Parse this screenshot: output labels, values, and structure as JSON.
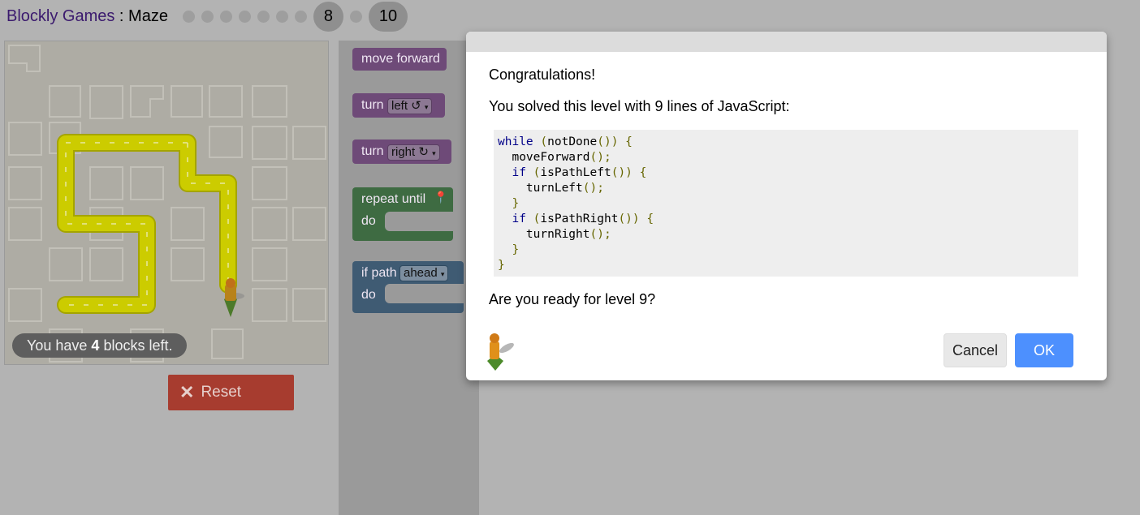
{
  "header": {
    "app_title": "Blockly Games",
    "separator": " : ",
    "game_title": "Maze",
    "levels": [
      "1",
      "2",
      "3",
      "4",
      "5",
      "6",
      "7",
      "8",
      "9",
      "10"
    ],
    "current_level": "8",
    "last_level": "10"
  },
  "maze": {
    "capacity_prefix": "You have ",
    "capacity_count": "4",
    "capacity_suffix": " blocks left."
  },
  "reset": {
    "icon": "close-icon",
    "label": "Reset"
  },
  "toolbox": {
    "move_forward": "move forward",
    "turn_label": "turn",
    "turn_left_option": "left ↺",
    "turn_right_option": "right ↻",
    "repeat_label": "repeat until",
    "do_label": "do",
    "if_path_label": "if path",
    "if_path_option": "ahead",
    "if_do_label": "do"
  },
  "dialog": {
    "congrats": "Congratulations!",
    "solved_text": "You solved this level with 9 lines of JavaScript:",
    "code": [
      "while (notDone()) {",
      "  moveForward();",
      "  if (isPathLeft()) {",
      "    turnLeft();",
      "  }",
      "  if (isPathRight()) {",
      "    turnRight();",
      "  }",
      "}"
    ],
    "ready_text": "Are you ready for level 9?",
    "cancel_label": "Cancel",
    "ok_label": "OK"
  },
  "colors": {
    "overlay_bg": "#b3b3b3",
    "ok_button": "#4d90fe",
    "reset_button": "#a73c2f",
    "path": "#cccc00"
  }
}
